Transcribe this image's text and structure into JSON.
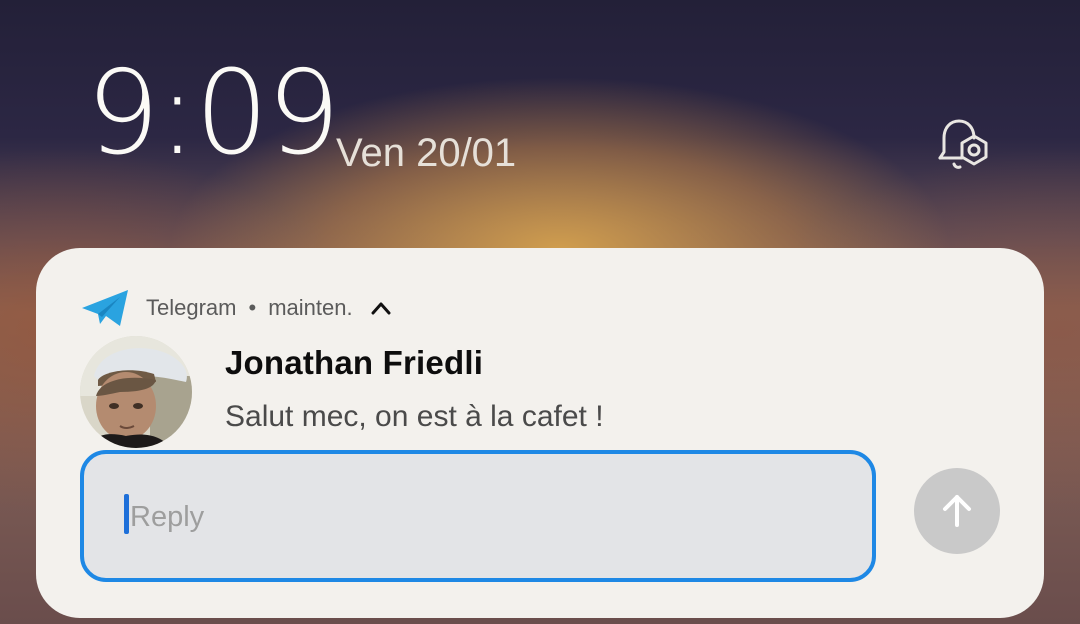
{
  "lockscreen": {
    "time": "9:09",
    "date": "Ven 20/01",
    "status_icon": "bell-settings-icon"
  },
  "notification": {
    "app_name": "Telegram",
    "separator": "•",
    "timestamp": "mainten.",
    "app_icon": "telegram-icon",
    "expand_icon": "chevron-up-icon",
    "sender": "Jonathan Friedli",
    "message": "Salut mec, on est à la cafet !",
    "reply": {
      "placeholder": "Reply",
      "value": ""
    },
    "send_icon": "arrow-up-icon",
    "colors": {
      "accent": "#1e88e5",
      "telegram": "#2aa3e0",
      "card": "#f3f1ed",
      "send_disabled": "#c9c9c9"
    }
  }
}
